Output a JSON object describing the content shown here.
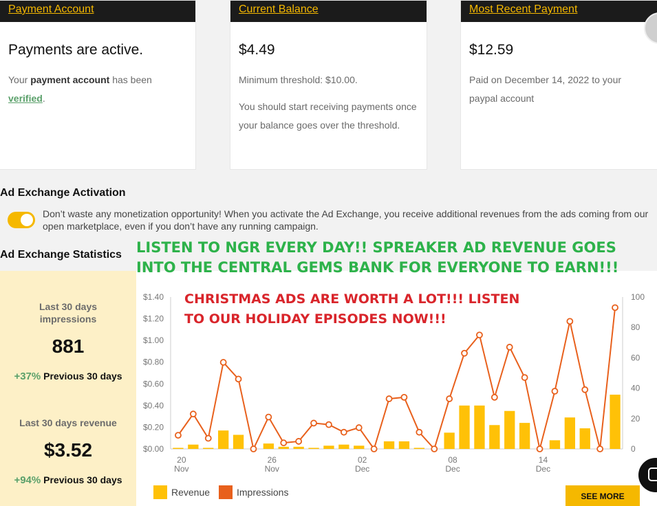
{
  "cards": {
    "payment_account": {
      "title": "Payment Account",
      "headline": "Payments are active.",
      "text_prefix": "Your ",
      "text_bold": "payment account",
      "text_middle": " has been",
      "link": "verified",
      "text_end": "."
    },
    "current_balance": {
      "title": "Current Balance",
      "headline": "$4.49",
      "line1": "Minimum threshold: $10.00.",
      "line2": "You should start receiving payments once your balance goes over the threshold."
    },
    "recent_payment": {
      "title": "Most Recent Payment",
      "headline": "$12.59",
      "line1": "Paid on December 14, 2022 to your paypal account"
    }
  },
  "ad_exchange": {
    "heading": "Ad Exchange Activation",
    "toggle_on": true,
    "description": "Don’t waste any monetization opportunity! When you activate the Ad Exchange, you receive additional revenues from the ads coming from our open marketplace, even if you don’t have any running campaign."
  },
  "stats": {
    "heading": "Ad Exchange Statistics",
    "impressions_label": "Last 30 days impressions",
    "impressions_value": "881",
    "impressions_change": "+37%",
    "impressions_compare": "Previous 30 days",
    "revenue_label": "Last 30 days revenue",
    "revenue_value": "$3.52",
    "revenue_change": "+94%",
    "revenue_compare": "Previous 30 days"
  },
  "overlays": {
    "green_line1": "LISTEN TO NGR EVERY DAY!! SPREAKER AD REVENUE GOES",
    "green_line2": "INTO THE CENTRAL GEMS BANK FOR EVERYONE TO EARN!!!",
    "red_line1": "CHRISTMAS ADS ARE WORTH A LOT!!! LISTEN",
    "red_line2": "TO OUR HOLIDAY EPISODES NOW!!!"
  },
  "chart_data": {
    "type": "bar",
    "categories": [
      "Nov 19",
      "Nov 20",
      "Nov 21",
      "Nov 22",
      "Nov 23",
      "Nov 24",
      "Nov 25",
      "Nov 26",
      "Nov 27",
      "Nov 28",
      "Nov 29",
      "Nov 30",
      "Dec 01",
      "Dec 02",
      "Dec 03",
      "Dec 04",
      "Dec 05",
      "Dec 06",
      "Dec 07",
      "Dec 08",
      "Dec 09",
      "Dec 10",
      "Dec 11",
      "Dec 12",
      "Dec 13",
      "Dec 14",
      "Dec 15",
      "Dec 16",
      "Dec 17",
      "Dec 18"
    ],
    "x_tick_labels": [
      {
        "day": "20",
        "month": "Nov",
        "index": 1
      },
      {
        "day": "26",
        "month": "Nov",
        "index": 7
      },
      {
        "day": "02",
        "month": "Dec",
        "index": 13
      },
      {
        "day": "08",
        "month": "Dec",
        "index": 19
      },
      {
        "day": "14",
        "month": "Dec",
        "index": 25
      }
    ],
    "series": [
      {
        "name": "Revenue",
        "type": "bar",
        "axis": "left",
        "color": "#ffc107",
        "values": [
          0.01,
          0.04,
          0.01,
          0.17,
          0.13,
          0,
          0.05,
          0.02,
          0.02,
          0.01,
          0.03,
          0.04,
          0.03,
          0,
          0.07,
          0.07,
          0.01,
          0,
          0.15,
          0.4,
          0.4,
          0.22,
          0.35,
          0.24,
          0,
          0.08,
          0.29,
          0.19,
          0,
          0.5
        ]
      },
      {
        "name": "Impressions",
        "type": "line",
        "axis": "right",
        "color": "#e8601c",
        "values": [
          9,
          23,
          7,
          57,
          46,
          0,
          21,
          4,
          5,
          17,
          16,
          11,
          14,
          0,
          33,
          34,
          11,
          0,
          33,
          63,
          75,
          34,
          67,
          47,
          0,
          38,
          84,
          39,
          0,
          93
        ]
      }
    ],
    "y_left": {
      "ticks": [
        "$0.00",
        "$0.20",
        "$0.40",
        "$0.60",
        "$0.80",
        "$1.00",
        "$1.20",
        "$1.40"
      ],
      "max": 1.4
    },
    "y_right": {
      "ticks": [
        "0",
        "20",
        "40",
        "60",
        "80",
        "100"
      ],
      "max": 100
    },
    "legend": [
      "Revenue",
      "Impressions"
    ],
    "legend_position": "bottom-left",
    "grid": false
  },
  "see_more": "SEE MORE"
}
